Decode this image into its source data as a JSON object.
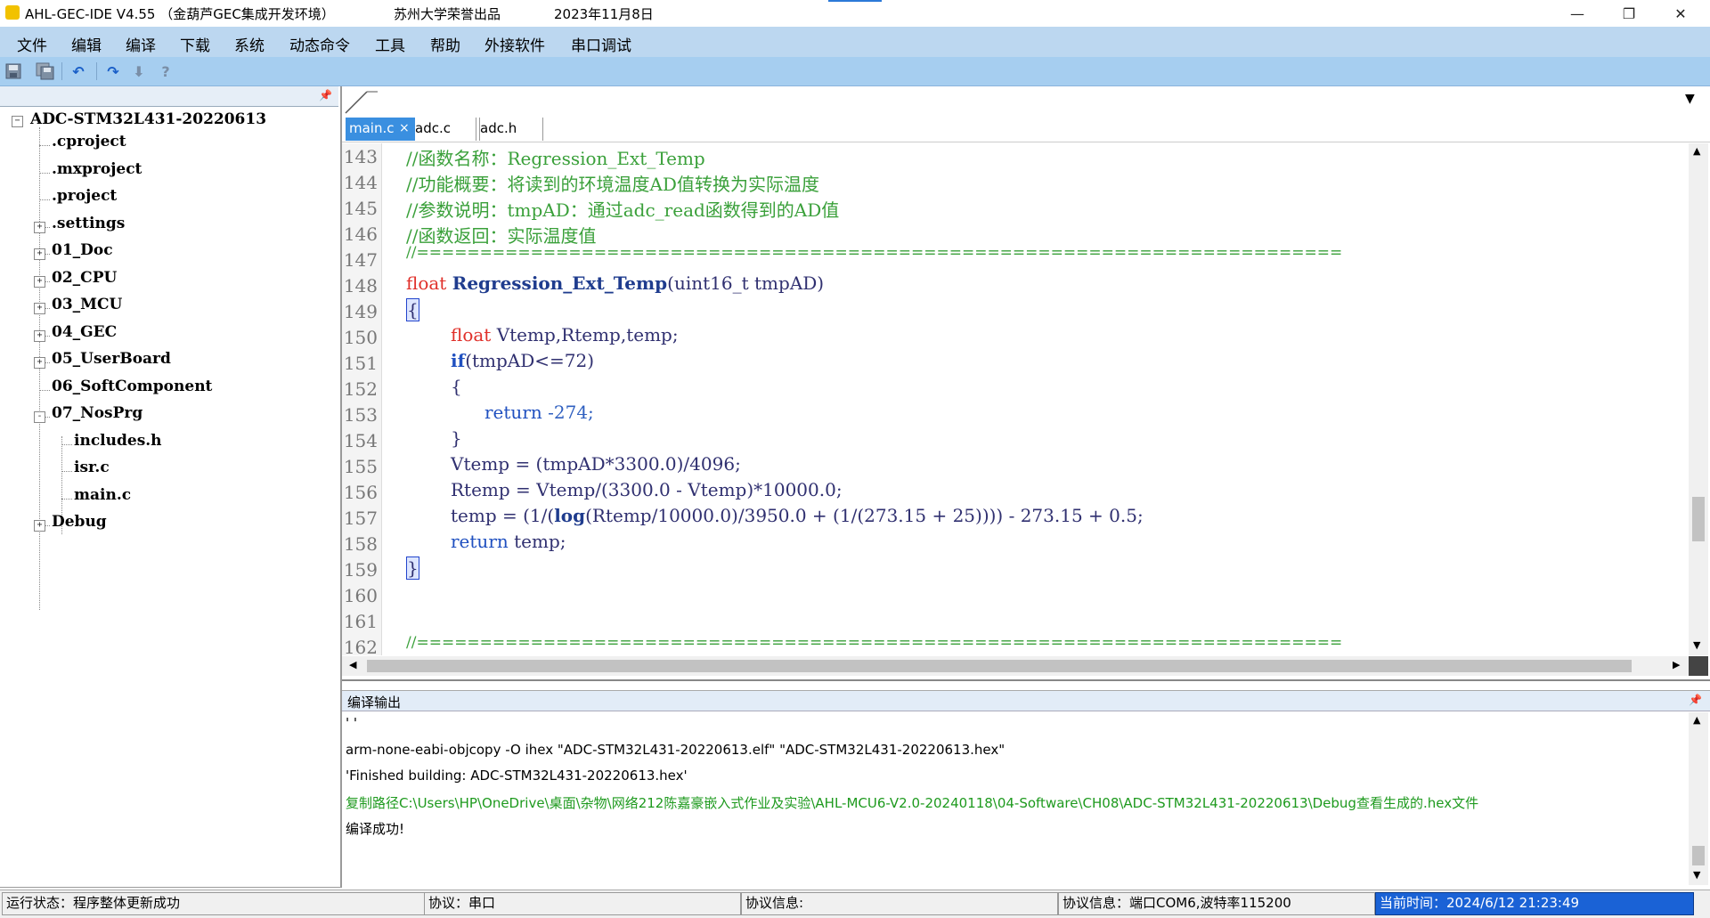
{
  "titlebar": {
    "app_title": "AHL-GEC-IDE V4.55  （金葫芦GEC集成开发环境）",
    "org": "苏州大学荣誉出品",
    "date": "2023年11月8日",
    "minimize": "—",
    "restore": "❐",
    "close": "✕"
  },
  "menu": [
    "文件",
    "编辑",
    "编译",
    "下载",
    "系统",
    "动态命令",
    "工具",
    "帮助",
    "外接软件",
    "串口调试"
  ],
  "toolbar_icons": [
    "save-icon",
    "save-all-icon",
    "undo-icon",
    "redo-icon",
    "download-icon",
    "help-icon"
  ],
  "project_tree": {
    "root": "ADC-STM32L431-20220613",
    "items": [
      {
        "label": ".cproject",
        "expander": ""
      },
      {
        "label": ".mxproject",
        "expander": ""
      },
      {
        "label": ".project",
        "expander": ""
      },
      {
        "label": ".settings",
        "expander": "+"
      },
      {
        "label": "01_Doc",
        "expander": "+"
      },
      {
        "label": "02_CPU",
        "expander": "+"
      },
      {
        "label": "03_MCU",
        "expander": "+"
      },
      {
        "label": "04_GEC",
        "expander": "+"
      },
      {
        "label": "05_UserBoard",
        "expander": "+"
      },
      {
        "label": "06_SoftComponent",
        "expander": ""
      },
      {
        "label": "07_NosPrg",
        "expander": "-"
      },
      {
        "label": "includes.h",
        "expander": ""
      },
      {
        "label": "isr.c",
        "expander": ""
      },
      {
        "label": "main.c",
        "expander": ""
      },
      {
        "label": "Debug",
        "expander": "+"
      }
    ]
  },
  "editor": {
    "tabs": [
      "main.c",
      "adc.c",
      "adc.h"
    ],
    "active_tab": "main.c",
    "tab_close": "×",
    "line_numbers": [
      "143",
      "144",
      "145",
      "146",
      "147",
      "148",
      "149",
      "150",
      "151",
      "152",
      "153",
      "154",
      "155",
      "156",
      "157",
      "158",
      "159",
      "160",
      "161",
      "162"
    ],
    "code": {
      "l143": "//函数名称：Regression_Ext_Temp",
      "l144": "//功能概要：将读到的环境温度AD值转换为实际温度",
      "l145": "//参数说明：tmpAD：通过adc_read函数得到的AD值",
      "l146": "//函数返回：实际温度值",
      "l147": "//=========================================================================",
      "l148_kw": "float",
      "l148_fn": "Regression_Ext_Temp",
      "l148_rest": "(uint16_t tmpAD)",
      "l149": "{",
      "l150_kw": "float",
      "l150_rest": " Vtemp,Rtemp,temp;",
      "l151_kw": "if",
      "l151_rest": "(tmpAD<=72)",
      "l152": "{",
      "l153_kw": "return",
      "l153_rest": " -274;",
      "l154": "}",
      "l155": "Vtemp = (tmpAD*3300.0)/4096;",
      "l156": "Rtemp = Vtemp/(3300.0 - Vtemp)*10000.0;",
      "l157_a": "temp = (1/(",
      "l157_fn": "log",
      "l157_b": "(Rtemp/10000.0)/3950.0 + (1/(273.15 + 25)))) - 273.15 + 0.5;",
      "l158_kw": "return",
      "l158_rest": " temp;",
      "l159": "}",
      "l162": "//========================================================================="
    }
  },
  "output": {
    "title": "编译输出",
    "lines": [
      "' '",
      "arm-none-eabi-objcopy -O ihex \"ADC-STM32L431-20220613.elf\"  \"ADC-STM32L431-20220613.hex\"",
      "'Finished building: ADC-STM32L431-20220613.hex'",
      "复制路径C:\\Users\\HP\\OneDrive\\桌面\\杂物\\网络212陈嘉豪嵌入式作业及实验\\AHL-MCU6-V2.0-20240118\\04-Software\\CH08\\ADC-STM32L431-20220613\\Debug查看生成的.hex文件",
      "编译成功!"
    ]
  },
  "status": {
    "run_state": "运行状态：程序整体更新成功",
    "protocol": "协议：串口",
    "protocol_info": "协议信息:",
    "protocol_info2": "协议信息：端口COM6,波特率115200",
    "current_time": "当前时间：2024/6/12 21:23:49"
  },
  "colors": {
    "menubar": "#bcd7f0",
    "toolbar": "#a6cef0",
    "active_tab": "#3a8fe0",
    "time_cell": "#1a62d6"
  }
}
